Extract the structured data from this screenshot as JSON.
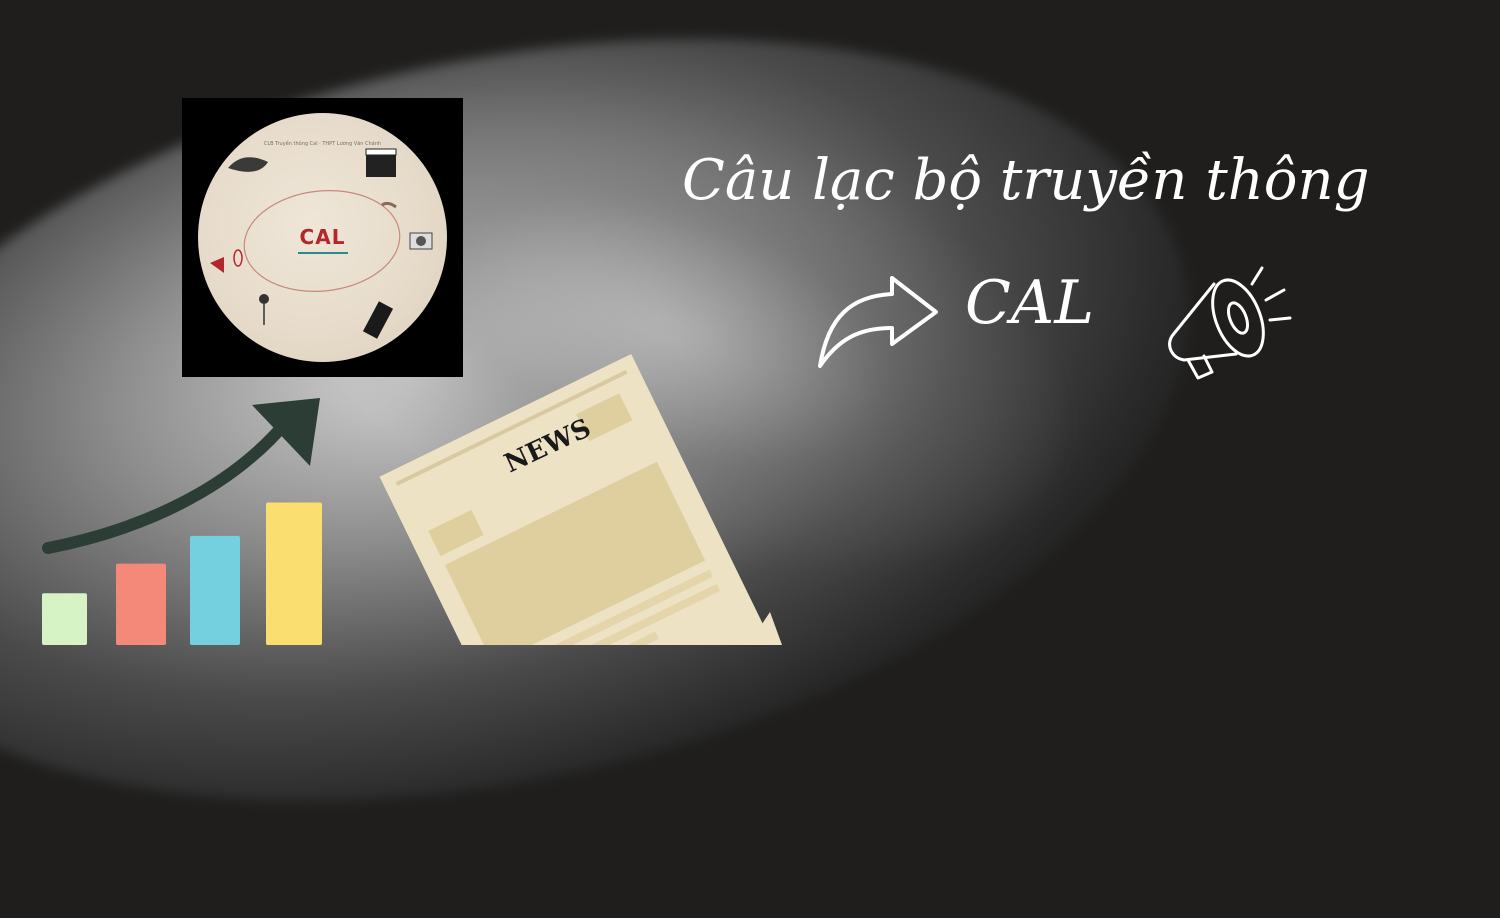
{
  "logo": {
    "name": "CAL",
    "tiny_caption": "CLB Truyền thông Cal · THPT Lương Văn Chánh"
  },
  "headline": "Câu lạc bộ truyền thông",
  "subheadline": "CAL",
  "news_label": "NEWS",
  "colors": {
    "background": "#1f1e1d",
    "text": "#ffffff",
    "bar_1": "#d5f3c5",
    "bar_2": "#f4897a",
    "bar_3": "#74cfdf",
    "bar_4": "#fbde70",
    "growth_arrow": "#2b3d35",
    "paper": "#eee2c5"
  },
  "bars": [
    0.28,
    0.44,
    0.59,
    0.77
  ],
  "icons": [
    "growth-arrow-icon",
    "curved-arrow-icon",
    "megaphone-icon",
    "newspaper-icon"
  ]
}
